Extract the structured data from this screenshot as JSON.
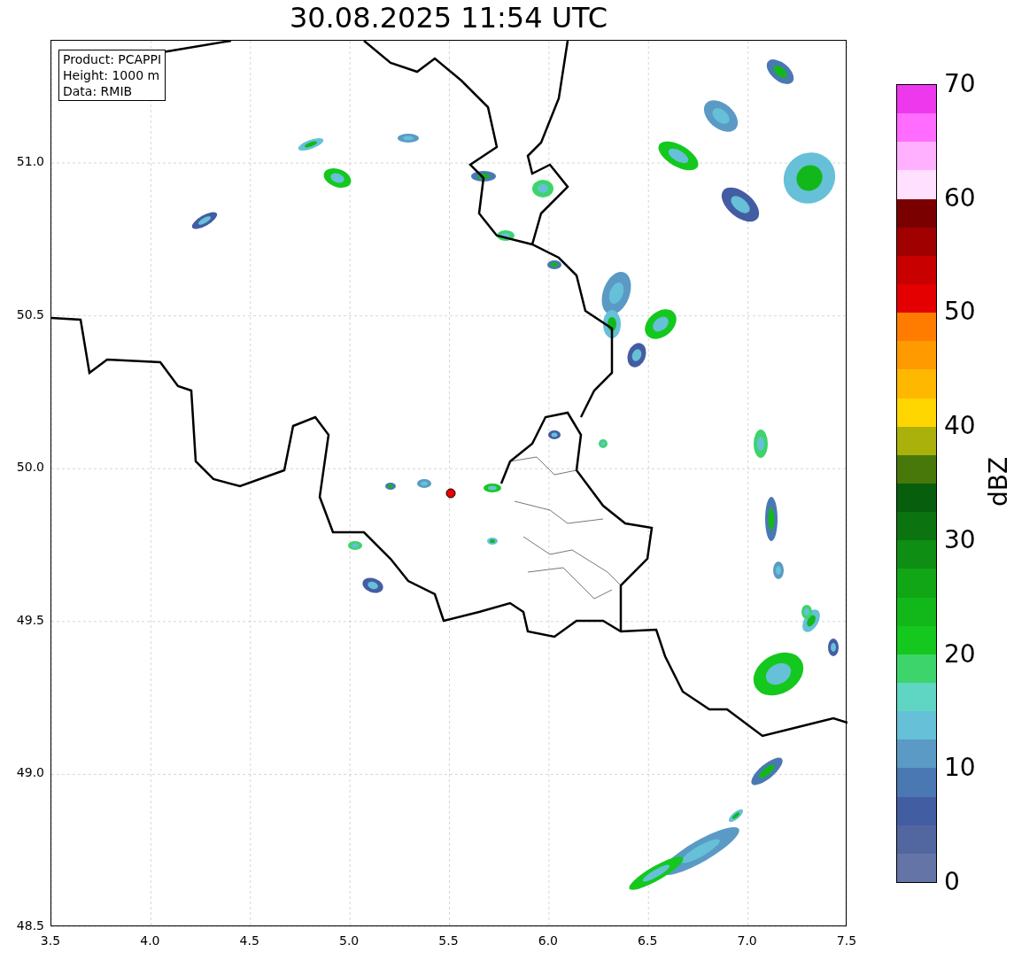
{
  "title": "30.08.2025 11:54 UTC",
  "info_box": [
    "Product: PCAPPI",
    "Height: 1000 m",
    "Data: RMIB"
  ],
  "map": {
    "xticks": [
      "3.5",
      "4.0",
      "4.5",
      "5.0",
      "5.5",
      "6.0",
      "6.5",
      "7.0",
      "7.5"
    ],
    "yticks": [
      "51.0",
      "50.5",
      "50.0",
      "49.5",
      "49.0",
      "48.5"
    ]
  },
  "colorbar": {
    "label": "dBZ",
    "ticks": [
      "70",
      "60",
      "50",
      "40",
      "30",
      "20",
      "10",
      "0"
    ],
    "bands": [
      {
        "color": "#6474a6"
      },
      {
        "color": "#5266a0"
      },
      {
        "color": "#435da3"
      },
      {
        "color": "#4a78b2"
      },
      {
        "color": "#5a9ac4"
      },
      {
        "color": "#66c0d8"
      },
      {
        "color": "#5fd6c4"
      },
      {
        "color": "#3dd46c"
      },
      {
        "color": "#14c81e"
      },
      {
        "color": "#12b81a"
      },
      {
        "color": "#10a616"
      },
      {
        "color": "#0e8e12"
      },
      {
        "color": "#0b7410"
      },
      {
        "color": "#075e0c"
      },
      {
        "color": "#48780a"
      },
      {
        "color": "#aab10a"
      },
      {
        "color": "#ffd600"
      },
      {
        "color": "#ffb800"
      },
      {
        "color": "#ff9a00"
      },
      {
        "color": "#ff7c00"
      },
      {
        "color": "#e40000"
      },
      {
        "color": "#c80000"
      },
      {
        "color": "#a00000"
      },
      {
        "color": "#7a0000"
      },
      {
        "color": "#ffe0ff"
      },
      {
        "color": "#ffb0ff"
      },
      {
        "color": "#ff6cff"
      },
      {
        "color": "#ee38ee"
      }
    ]
  }
}
